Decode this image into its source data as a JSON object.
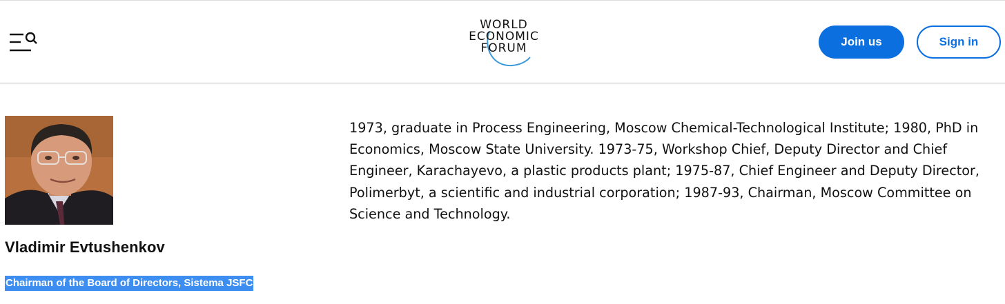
{
  "header": {
    "logo_lines": [
      "WORLD",
      "ECONOMIC",
      "FORUM"
    ],
    "join_label": "Join us",
    "signin_label": "Sign in",
    "accent_color": "#0b6fe0"
  },
  "profile": {
    "name": "Vladimir Evtushenkov",
    "role": "Chairman of the Board of Directors, Sistema JSFC",
    "bio": "1973, graduate in Process Engineering, Moscow Chemical-Technological Institute; 1980, PhD in Economics, Moscow State University. 1973-75, Workshop Chief, Deputy Director and Chief Engineer, Karachayevo, a plastic products plant; 1975-87, Chief Engineer and Deputy Director, Polimerbyt, a scientific and industrial corporation; 1987-93, Chairman, Moscow Committee on Science and Technology.",
    "selection_color": "#3d8ef0"
  }
}
